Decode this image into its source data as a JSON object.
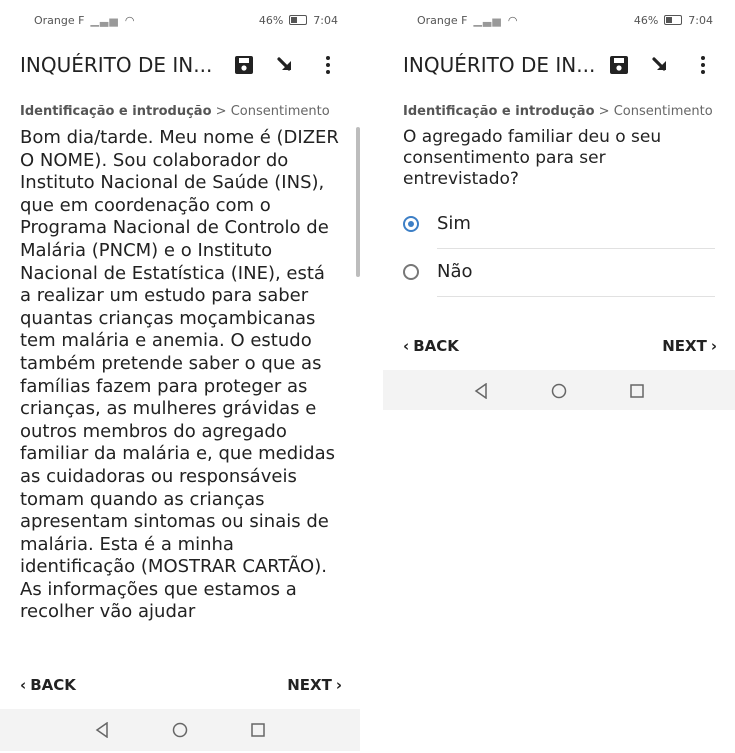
{
  "status": {
    "carrier": "Orange F",
    "battery": "46%",
    "time": "7:04"
  },
  "app": {
    "title": "INQUÉRITO DE IN...",
    "save_icon": "save-icon",
    "jump_icon": "arrow-icon",
    "menu_icon": "more-vert-icon"
  },
  "breadcrumb": {
    "section": "Identificação e introdução",
    "separator": ">",
    "page": "Consentimento"
  },
  "left": {
    "body": "Bom dia/tarde. Meu nome é (DIZER O NOME). Sou colaborador do Instituto Nacional de Saúde (INS), que em coordenação com o Programa Nacional de Controlo de Malária (PNCM) e o Instituto Nacional de Estatística (INE), está a realizar um estudo para saber quantas crianças moçambicanas tem malária e anemia. O estudo também pretende saber o que as famílias fazem para proteger as crianças, as mulheres grávidas e outros membros do agregado familiar da malária e, que medidas as cuidadoras ou responsáveis tomam quando as crianças apresentam sintomas ou sinais de malária. Esta é a minha identificação (MOSTRAR CARTÃO). As informações que estamos a recolher vão ajudar"
  },
  "right": {
    "question": "O agregado familiar deu o seu consentimento para ser entrevistado?",
    "options": [
      "Sim",
      "Não"
    ],
    "selected": "Sim"
  },
  "nav": {
    "back": "BACK",
    "next": "NEXT"
  }
}
